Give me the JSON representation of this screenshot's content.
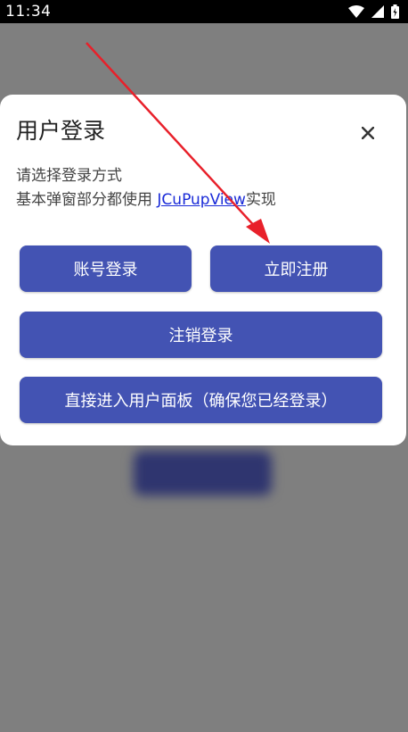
{
  "status_bar": {
    "time": "11:34",
    "icons": [
      "wifi-icon",
      "signal-icon",
      "battery-icon"
    ]
  },
  "dialog": {
    "title": "用户登录",
    "close_label": "×",
    "description_line1": "请选择登录方式",
    "description_line2_prefix": "基本弹窗部分都使用 ",
    "description_link": "JCuPupView",
    "description_line2_suffix": "实现",
    "buttons": {
      "account_login": "账号登录",
      "register_now": "立即注册",
      "logout": "注销登录",
      "enter_panel": "直接进入用户面板（确保您已经登录）"
    }
  },
  "colors": {
    "accent": "#4353b3",
    "overlay": "#7f7f7f",
    "link": "#1a2bd8",
    "annotation_arrow": "#e8202a"
  }
}
